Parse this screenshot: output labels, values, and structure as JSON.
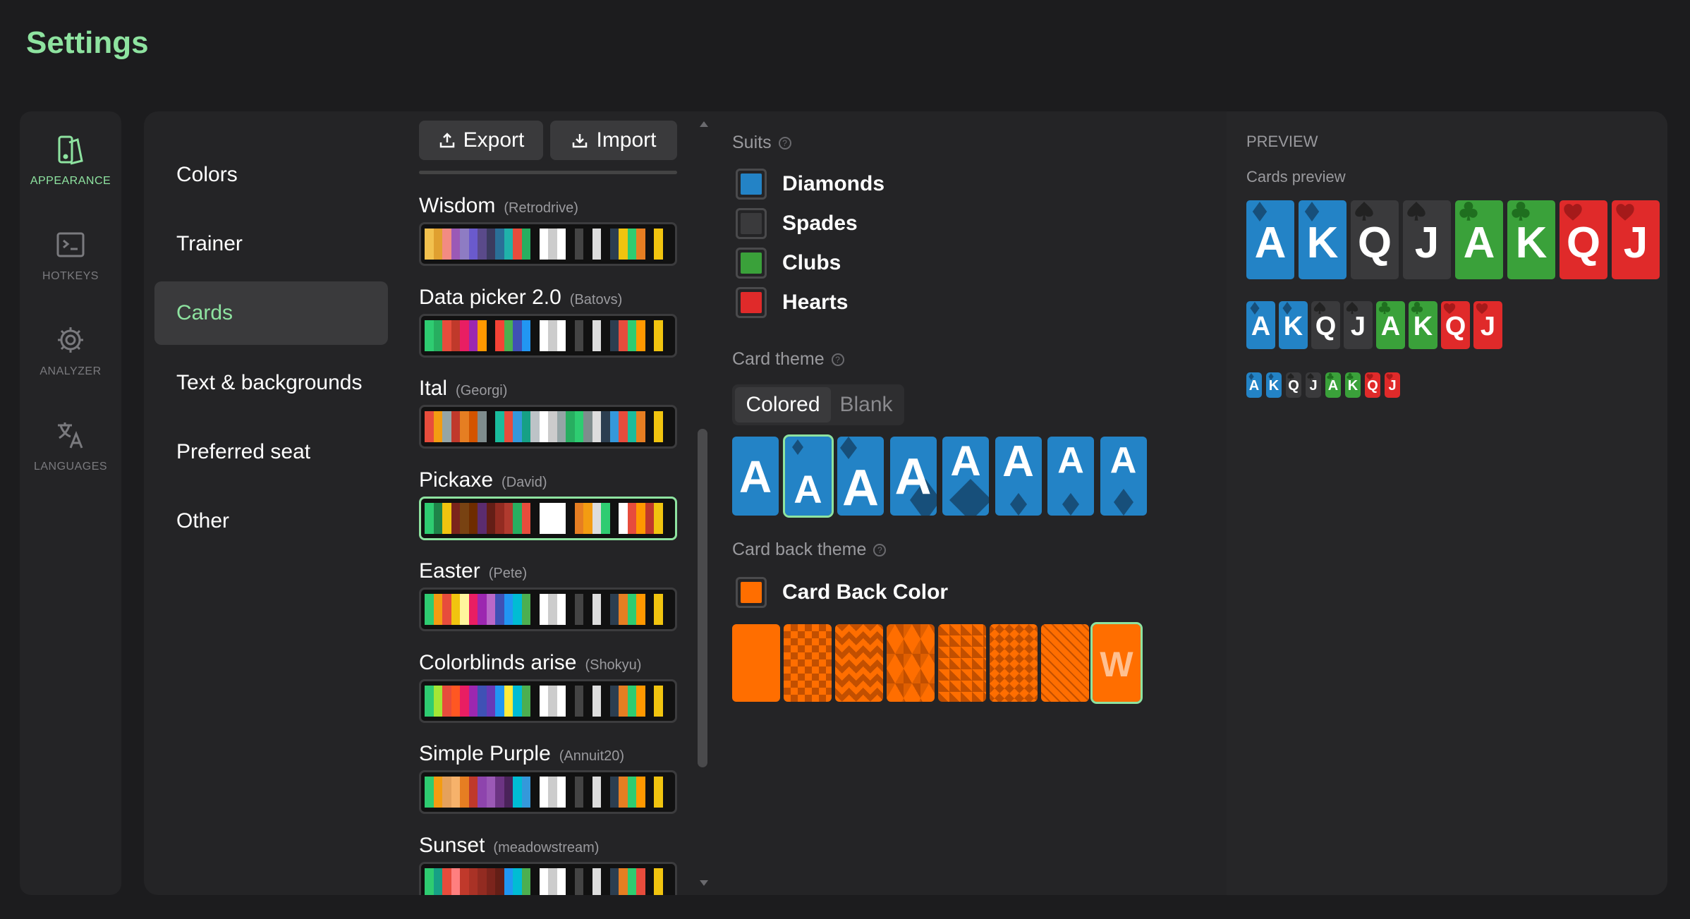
{
  "page": {
    "title": "Settings"
  },
  "rail": [
    {
      "label": "APPEARANCE",
      "icon": "appearance-icon",
      "active": true
    },
    {
      "label": "HOTKEYS",
      "icon": "terminal-icon",
      "active": false
    },
    {
      "label": "ANALYZER",
      "icon": "gear-icon",
      "active": false
    },
    {
      "label": "LANGUAGES",
      "icon": "translate-icon",
      "active": false
    }
  ],
  "nav": [
    {
      "label": "Colors"
    },
    {
      "label": "Trainer"
    },
    {
      "label": "Cards",
      "active": true
    },
    {
      "label": "Text & backgrounds"
    },
    {
      "label": "Preferred seat"
    },
    {
      "label": "Other"
    }
  ],
  "toolbar": {
    "export_label": "Export",
    "import_label": "Import"
  },
  "themes": [
    {
      "name": "Wisdom",
      "author": "(Retrodrive)",
      "colors": [
        "#f2c14e",
        "#e0a030",
        "#f28b82",
        "#9b59b6",
        "#8e7cc3",
        "#6a5acd",
        "#5a4a8a",
        "#3b3b5e",
        "#2a6f97",
        "#20b2aa",
        "#e74c3c",
        "#27ae60",
        "#111",
        "#fff",
        "#ccc",
        "#fff",
        "#111",
        "#444",
        "#111",
        "#ddd",
        "#111",
        "#2c3e50",
        "#f1c40f",
        "#2ecc71",
        "#e67e22",
        "#111",
        "#f1c40f",
        "#111"
      ]
    },
    {
      "name": "Data picker 2.0",
      "author": "(Batovs)",
      "colors": [
        "#2ecc71",
        "#27ae60",
        "#e74c3c",
        "#c0392b",
        "#e91e63",
        "#9c27b0",
        "#ff9800",
        "#111",
        "#f44336",
        "#4caf50",
        "#3f51b5",
        "#2196f3",
        "#111",
        "#fff",
        "#ccc",
        "#fff",
        "#111",
        "#444",
        "#111",
        "#ddd",
        "#111",
        "#2c3e50",
        "#e74c3c",
        "#2ecc71",
        "#ff9800",
        "#111",
        "#f1c40f",
        "#111"
      ]
    },
    {
      "name": "Ital",
      "author": "(Georgi)",
      "colors": [
        "#e74c3c",
        "#f39c12",
        "#95a5a6",
        "#c0392b",
        "#e67e22",
        "#d35400",
        "#7f8c8d",
        "#111",
        "#1abc9c",
        "#e74c3c",
        "#3498db",
        "#16a085",
        "#bdc3c7",
        "#fff",
        "#ccc",
        "#95a5a6",
        "#27ae60",
        "#2ecc71",
        "#7f8c8d",
        "#ddd",
        "#2c3e50",
        "#3498db",
        "#e74c3c",
        "#1abc9c",
        "#e67e22",
        "#111",
        "#f1c40f",
        "#111"
      ]
    },
    {
      "name": "Pickaxe",
      "author": "(David)",
      "colors": [
        "#2ecc71",
        "#1e8449",
        "#f1c40f",
        "#7b241c",
        "#784212",
        "#6e2c00",
        "#5b2c6f",
        "#641e16",
        "#922b21",
        "#b03a2e",
        "#27ae60",
        "#e74c3c",
        "#111",
        "#fff",
        "#fff",
        "#fff",
        "#111",
        "#e67e22",
        "#f39c12",
        "#ddd",
        "#2ecc71",
        "#111",
        "#fff",
        "#e74c3c",
        "#ff9800",
        "#c0392b",
        "#f1c40f",
        "#111"
      ],
      "active": true
    },
    {
      "name": "Easter",
      "author": "(Pete)",
      "colors": [
        "#2ecc71",
        "#f39c12",
        "#e74c3c",
        "#f1c40f",
        "#fff59d",
        "#e91e63",
        "#9c27b0",
        "#ba68c8",
        "#3f51b5",
        "#2196f3",
        "#00bcd4",
        "#4caf50",
        "#111",
        "#fff",
        "#ccc",
        "#fff",
        "#111",
        "#444",
        "#111",
        "#ddd",
        "#111",
        "#2c3e50",
        "#e67e22",
        "#2ecc71",
        "#ff9800",
        "#111",
        "#f1c40f",
        "#111"
      ]
    },
    {
      "name": "Colorblinds arise",
      "author": "(Shokyu)",
      "colors": [
        "#2ecc71",
        "#a3e635",
        "#e74c3c",
        "#ff5722",
        "#e91e63",
        "#9c27b0",
        "#3f51b5",
        "#673ab7",
        "#2196f3",
        "#ffeb3b",
        "#00bcd4",
        "#4caf50",
        "#111",
        "#fff",
        "#ccc",
        "#fff",
        "#111",
        "#444",
        "#111",
        "#ddd",
        "#111",
        "#2c3e50",
        "#e67e22",
        "#2ecc71",
        "#ff9800",
        "#111",
        "#f1c40f",
        "#111"
      ]
    },
    {
      "name": "Simple Purple",
      "author": "(Annuit20)",
      "colors": [
        "#2ecc71",
        "#f39c12",
        "#e5a15c",
        "#f6b26b",
        "#e67e22",
        "#c0392b",
        "#8e44ad",
        "#9b59b6",
        "#6c3483",
        "#4a235a",
        "#00bcd4",
        "#3498db",
        "#111",
        "#fff",
        "#ccc",
        "#fff",
        "#111",
        "#444",
        "#111",
        "#ddd",
        "#111",
        "#2c3e50",
        "#e67e22",
        "#2ecc71",
        "#ff9800",
        "#111",
        "#f1c40f",
        "#111"
      ]
    },
    {
      "name": "Sunset",
      "author": "(meadowstream)",
      "colors": [
        "#2ecc71",
        "#16a085",
        "#e74c3c",
        "#ff7f7f",
        "#c0392b",
        "#a93226",
        "#922b21",
        "#7b241c",
        "#641e16",
        "#2196f3",
        "#00bcd4",
        "#4caf50",
        "#111",
        "#fff",
        "#ccc",
        "#fff",
        "#111",
        "#444",
        "#111",
        "#ddd",
        "#111",
        "#2c3e50",
        "#e67e22",
        "#2ecc71",
        "#e74c3c",
        "#111",
        "#f1c40f",
        "#111"
      ]
    }
  ],
  "suits": {
    "title": "Suits",
    "items": [
      {
        "label": "Diamonds",
        "color": "#2383c6"
      },
      {
        "label": "Spades",
        "color": "#3a3a3c"
      },
      {
        "label": "Clubs",
        "color": "#3aa13a"
      },
      {
        "label": "Hearts",
        "color": "#e02a2a"
      }
    ]
  },
  "card_theme": {
    "title": "Card theme",
    "options": [
      "Colored",
      "Blank"
    ],
    "selected": "Colored",
    "sample_rank": "A",
    "selected_index": 1
  },
  "card_back": {
    "title": "Card back theme",
    "color_label": "Card Back Color",
    "color": "#ff6e00",
    "patterns": [
      "solid",
      "checker",
      "zigzag",
      "cubes",
      "triangles",
      "diamonds",
      "stripes",
      "logo"
    ],
    "logo_letter": "W",
    "selected_index": 7
  },
  "preview": {
    "heading": "PREVIEW",
    "subheading": "Cards preview",
    "cards": [
      {
        "rank": "A",
        "suit": "diamonds"
      },
      {
        "rank": "K",
        "suit": "diamonds"
      },
      {
        "rank": "Q",
        "suit": "spades"
      },
      {
        "rank": "J",
        "suit": "spades"
      },
      {
        "rank": "A",
        "suit": "clubs"
      },
      {
        "rank": "K",
        "suit": "clubs"
      },
      {
        "rank": "Q",
        "suit": "hearts"
      },
      {
        "rank": "J",
        "suit": "hearts"
      }
    ]
  }
}
